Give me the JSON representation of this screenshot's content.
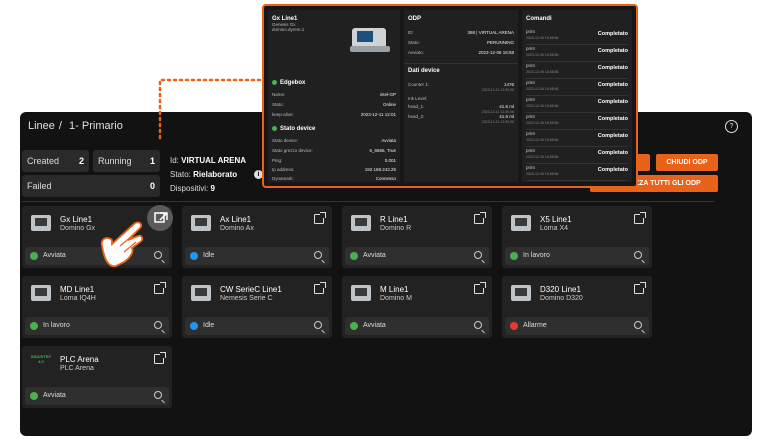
{
  "breadcrumb": {
    "first": "Linee",
    "sep": "/",
    "second": "1- Primario"
  },
  "stats": {
    "created_label": "Created",
    "created_value": "2",
    "running_label": "Running",
    "running_value": "1",
    "failed_label": "Failed",
    "failed_value": "0"
  },
  "odp": {
    "id_label": "Id:",
    "id_value": "VIRTUAL ARENA",
    "state_label": "Stato:",
    "state_value": "Rielaborato",
    "devices_label": "Dispositivi:",
    "devices_value": "9"
  },
  "buttons": {
    "close_odp": "CHIUDI ODP",
    "view_all_odp": "VISUALIZZA TUTTI GLI ODP"
  },
  "status_colors": {
    "green": "#4caf50",
    "blue": "#2196f3",
    "red": "#e53935"
  },
  "cards": [
    {
      "name": "Gx Line1",
      "model": "Domino Gx",
      "status": "Avviata",
      "color": "green"
    },
    {
      "name": "Ax Line1",
      "model": "Domino Ax",
      "status": "Idle",
      "color": "blue"
    },
    {
      "name": "R Line1",
      "model": "Domino R",
      "status": "Avviata",
      "color": "green"
    },
    {
      "name": "X5 Line1",
      "model": "Loma X4",
      "status": "In lavoro",
      "color": "green"
    },
    {
      "name": "MD Line1",
      "model": "Loma IQ4H",
      "status": "In lavoro",
      "color": "green"
    },
    {
      "name": "CW SerieC Line1",
      "model": "Nemesis Serie C",
      "status": "Idle",
      "color": "blue"
    },
    {
      "name": "M Line1",
      "model": "Domino M",
      "status": "Avviata",
      "color": "green"
    },
    {
      "name": "D320 Line1",
      "model": "Domino D320",
      "status": "Allarme",
      "color": "red"
    },
    {
      "name": "PLC Arena",
      "model": "PLC Arena",
      "status": "Avviata",
      "color": "green",
      "thumb_text": "INDUSTRY 4.0"
    }
  ],
  "popup": {
    "device": {
      "name": "Gx Line1",
      "sub1": "Genesis Gx",
      "sub2": "domino.dyrem.1"
    },
    "edgebox": {
      "title": "Edgebox",
      "rows": [
        {
          "k": "Name:",
          "v": "intel-GP"
        },
        {
          "k": "Stato:",
          "v": "Online"
        },
        {
          "k": "keep-alive:",
          "v": "2023-12-11 12:01"
        }
      ]
    },
    "device_state": {
      "title": "Stato device",
      "rows": [
        {
          "k": "Stato device:",
          "v": "Avviata"
        },
        {
          "k": "Stato grezzo device:",
          "v": "6_6666, True"
        },
        {
          "k": "Ping:",
          "v": "0.001"
        },
        {
          "k": "Ip address:",
          "v": "192.168.243.25"
        },
        {
          "k": "Dynamark:",
          "v": "Connesso"
        }
      ]
    },
    "odp_section": {
      "title": "ODP",
      "rows": [
        {
          "k": "ID:",
          "v": "368 | VIRTUAL ARENA"
        },
        {
          "k": "Stato:",
          "v": "PERUNNING"
        },
        {
          "k": "Avviato:",
          "v": "2023-12-06 16:58"
        }
      ]
    },
    "device_data": {
      "title": "Dati device",
      "rows": [
        {
          "k": "Counter 1:",
          "v": "1476",
          "t": "2023-12-11 12:30:06"
        },
        {
          "k": "Ink Level:",
          "v": "",
          "t": ""
        },
        {
          "k": "head_1:",
          "v": "41.6 ml",
          "t": "2023-12-11 12:30:06"
        },
        {
          "k": "head_2:",
          "v": "41.6 ml",
          "t": "2023-12-11 12:30:06"
        }
      ]
    },
    "commands": {
      "title": "Comandi",
      "items": [
        {
          "cmd": "print",
          "ts": "2023-12-06 16:58:56",
          "state": "Completato"
        },
        {
          "cmd": "print",
          "ts": "2023-12-06 16:58:56",
          "state": "Completato"
        },
        {
          "cmd": "print",
          "ts": "2023-12-06 16:58:56",
          "state": "Completato"
        },
        {
          "cmd": "print",
          "ts": "2023-12-06 16:58:56",
          "state": "Completato"
        },
        {
          "cmd": "print",
          "ts": "2023-12-06 16:58:56",
          "state": "Completato"
        },
        {
          "cmd": "print",
          "ts": "2023-12-06 16:58:56",
          "state": "Completato"
        },
        {
          "cmd": "print",
          "ts": "2023-12-06 16:58:56",
          "state": "Completato"
        },
        {
          "cmd": "print",
          "ts": "2023-12-06 16:58:56",
          "state": "Completato"
        },
        {
          "cmd": "print",
          "ts": "2023-12-06 16:58:56",
          "state": "Completato"
        }
      ]
    }
  }
}
